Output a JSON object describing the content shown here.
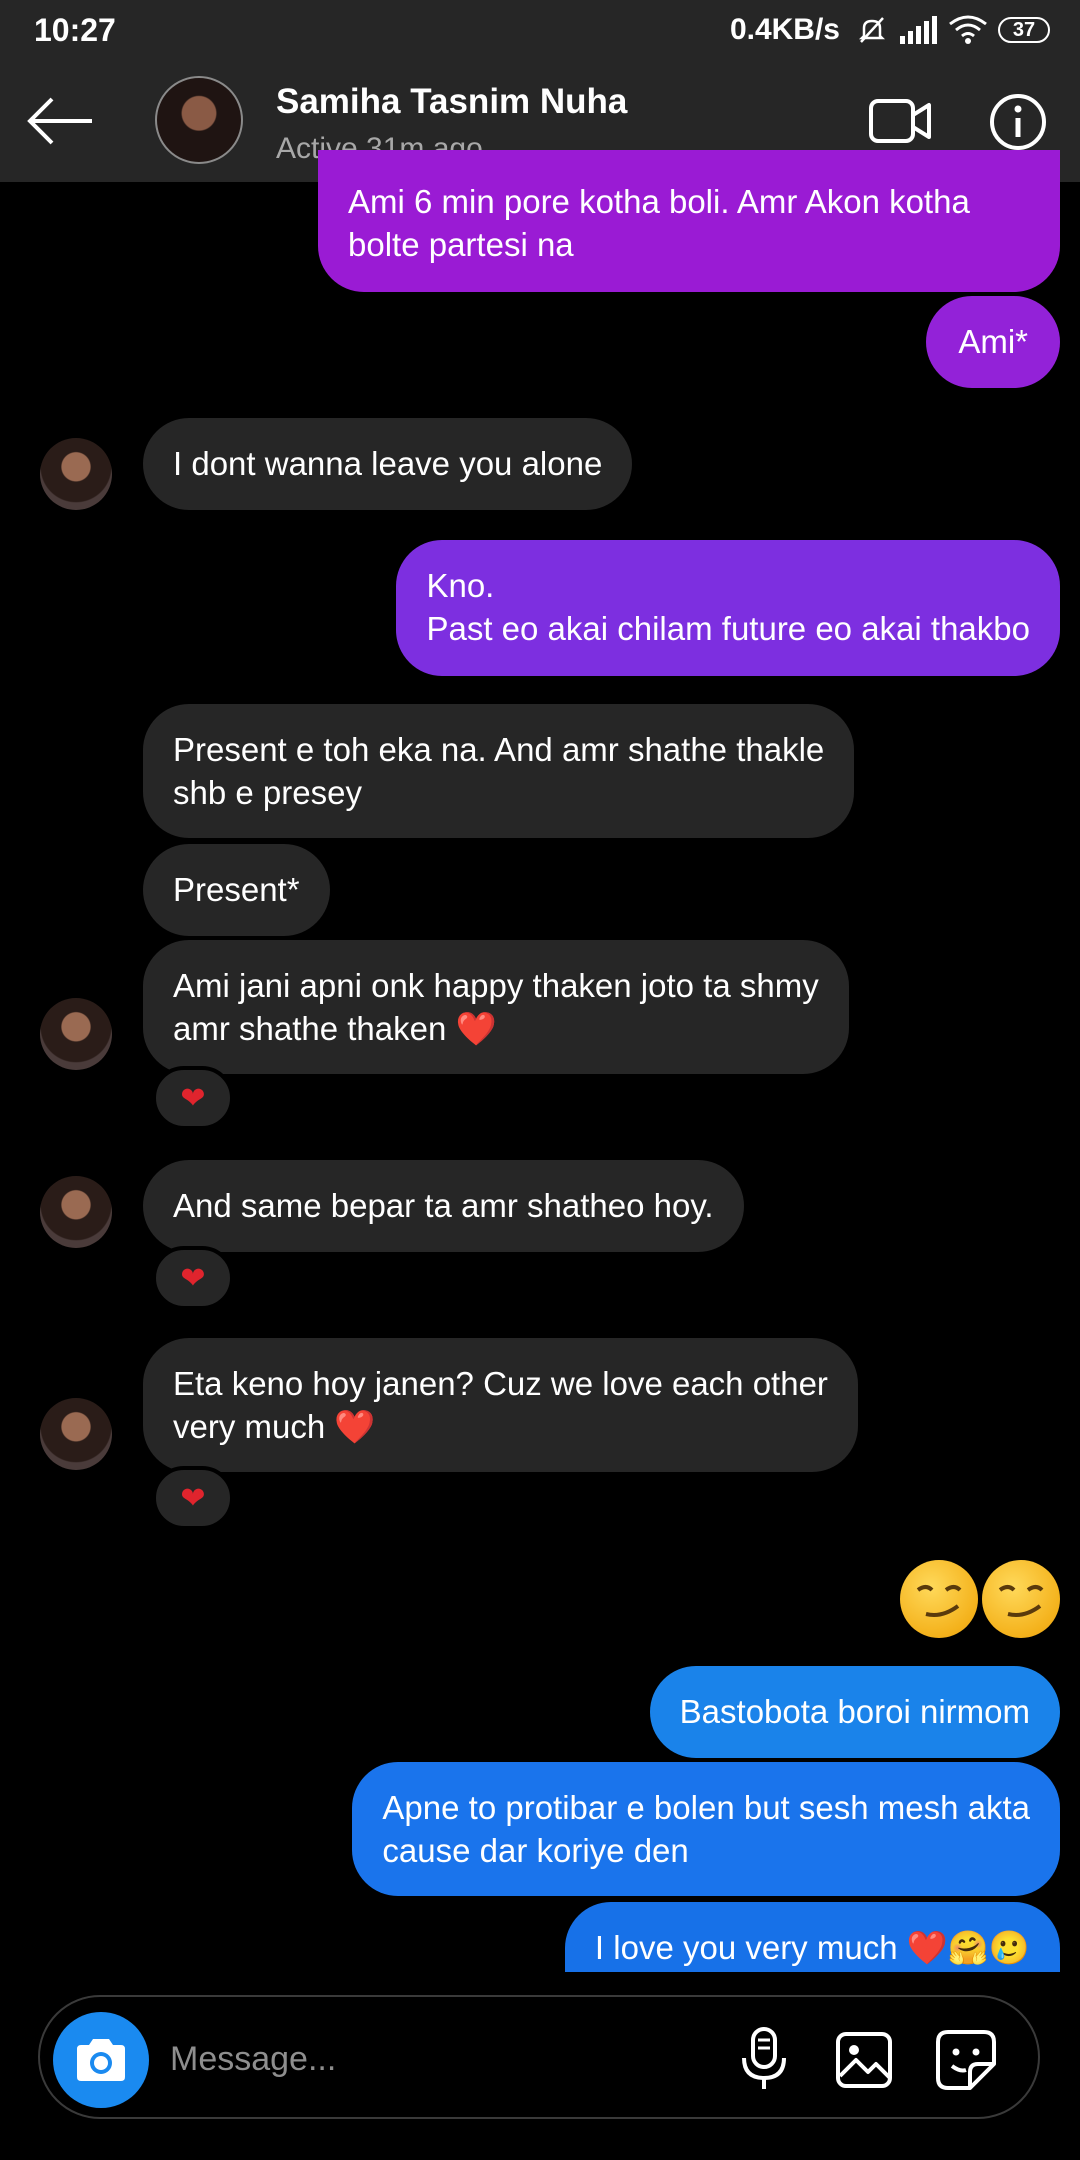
{
  "status_bar": {
    "time": "10:27",
    "network_speed": "0.4KB/s",
    "battery": "37"
  },
  "header": {
    "name": "Samiha Tasnim Nuha",
    "status": "Active 31m ago",
    "icons": [
      "back-arrow-icon",
      "video-call-icon",
      "info-icon"
    ]
  },
  "messages": [
    {
      "from": "me",
      "lines": [
        "Ami 6 min pore kotha boli. Amr Akon kotha",
        "bolte partesi na"
      ]
    },
    {
      "from": "me",
      "lines": [
        "Ami*"
      ]
    },
    {
      "from": "them",
      "lines": [
        "I dont wanna leave you alone"
      ]
    },
    {
      "from": "me",
      "lines": [
        "Kno.",
        " Past eo akai chilam future eo akai thakbo"
      ]
    },
    {
      "from": "them",
      "lines": [
        "Present e toh eka na. And amr shathe thakle",
        "shb e presey"
      ]
    },
    {
      "from": "them",
      "lines": [
        "Present*"
      ]
    },
    {
      "from": "them",
      "lines": [
        "Ami jani apni onk happy thaken joto ta shmy",
        "amr shathe thaken"
      ],
      "trailing": "❤️",
      "reaction": "❤"
    },
    {
      "from": "them",
      "lines": [
        "And same bepar ta amr shatheo hoy."
      ],
      "reaction": "❤"
    },
    {
      "from": "them",
      "lines": [
        "Eta keno hoy janen? Cuz we love each other",
        "very much"
      ],
      "trailing": "❤️",
      "reaction": "❤"
    },
    {
      "from": "me",
      "emoji": "smirking-face x2"
    },
    {
      "from": "me",
      "lines": [
        "Bastobota boroi nirmom"
      ]
    },
    {
      "from": "me",
      "lines": [
        "Apne to protibar e bolen but sesh mesh akta",
        "cause dar koriye den"
      ]
    },
    {
      "from": "me",
      "lines": [
        "I love you very much"
      ],
      "trailing": "❤️🤗🥲"
    }
  ],
  "composer": {
    "placeholder": "Message...",
    "icons": [
      "camera-icon",
      "microphone-icon",
      "gallery-icon",
      "sticker-icon"
    ]
  },
  "colors": {
    "background": "#000000",
    "bar": "#262626",
    "incoming": "#262626",
    "outgoing_top": "#9a1bd4",
    "outgoing_bottom": "#1a83ea",
    "accent": "#1a8af0"
  }
}
